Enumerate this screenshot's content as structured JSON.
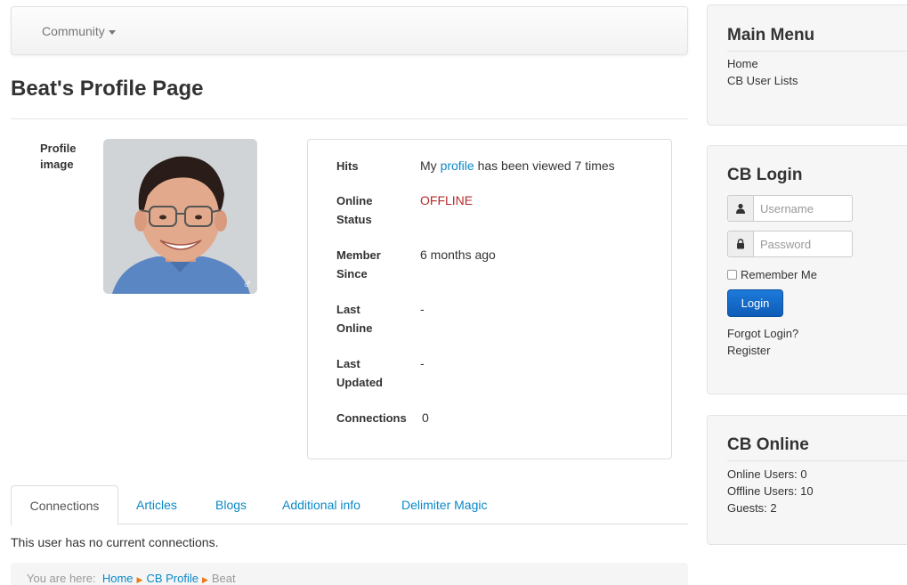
{
  "nav": {
    "community_label": "Community"
  },
  "page": {
    "title": "Beat's Profile Page"
  },
  "profile": {
    "image_label_line1": "Profile",
    "image_label_line2": "image",
    "gender_symbol": "♂"
  },
  "info": {
    "hits_label": "Hits",
    "hits_prefix": "My ",
    "hits_link": "profile",
    "hits_suffix": " has been viewed 7 times",
    "online_status_label_1": "Online",
    "online_status_label_2": "Status",
    "online_status_value": "OFFLINE",
    "member_since_label_1": "Member",
    "member_since_label_2": "Since",
    "member_since_value": "6 months ago",
    "last_online_label_1": "Last",
    "last_online_label_2": "Online",
    "last_online_value": "-",
    "last_updated_label_1": "Last",
    "last_updated_label_2": "Updated",
    "last_updated_value": "-",
    "connections_label": "Connections",
    "connections_value": "0"
  },
  "tabs": {
    "items": [
      {
        "label": "Connections"
      },
      {
        "label": "Articles"
      },
      {
        "label": "Blogs"
      },
      {
        "label": "Additional info"
      },
      {
        "label": "Delimiter Magic"
      }
    ],
    "active_index": 0
  },
  "connections_message": "This user has no current connections.",
  "breadcrumb": {
    "prefix": "You are here:",
    "items": [
      "Home",
      "CB Profile",
      "Beat"
    ]
  },
  "main_menu": {
    "title": "Main Menu",
    "links": [
      "Home",
      "CB User Lists"
    ]
  },
  "cb_login": {
    "title": "CB Login",
    "username_placeholder": "Username",
    "password_placeholder": "Password",
    "remember_label": "Remember Me",
    "login_button": "Login",
    "forgot_link": "Forgot Login?",
    "register_link": "Register"
  },
  "cb_online": {
    "title": "CB Online",
    "online_users": "Online Users: 0",
    "offline_users": "Offline Users: 10",
    "guests": "Guests: 2"
  },
  "colors": {
    "link": "#0a88c8",
    "offline": "#b52a2a",
    "button": "#1368c9"
  }
}
